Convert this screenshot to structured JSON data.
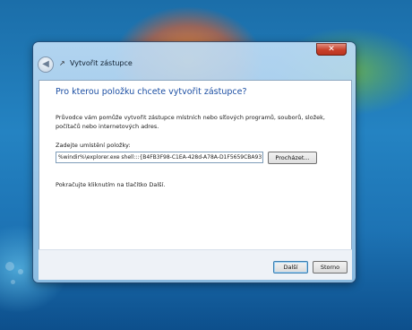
{
  "window": {
    "title": "Vytvořit zástupce",
    "back_icon": "back-arrow-icon",
    "app_icon": "shortcut-icon",
    "close_label": "✕"
  },
  "content": {
    "heading": "Pro kterou položku chcete vytvořit zástupce?",
    "description": "Průvodce vám pomůže vytvořit zástupce místních nebo síťových programů, souborů, složek, počítačů nebo internetových adres.",
    "location_label": "Zadejte umístění položky:",
    "location_value": "%windir%\\explorer.exe shell:::{B4FB3F98-C1EA-428d-A78A-D1F5659CBA93}",
    "browse_label": "Procházet...",
    "hint": "Pokračujte kliknutím na tlačítko Další."
  },
  "footer": {
    "next_label": "Další",
    "cancel_label": "Storno"
  }
}
